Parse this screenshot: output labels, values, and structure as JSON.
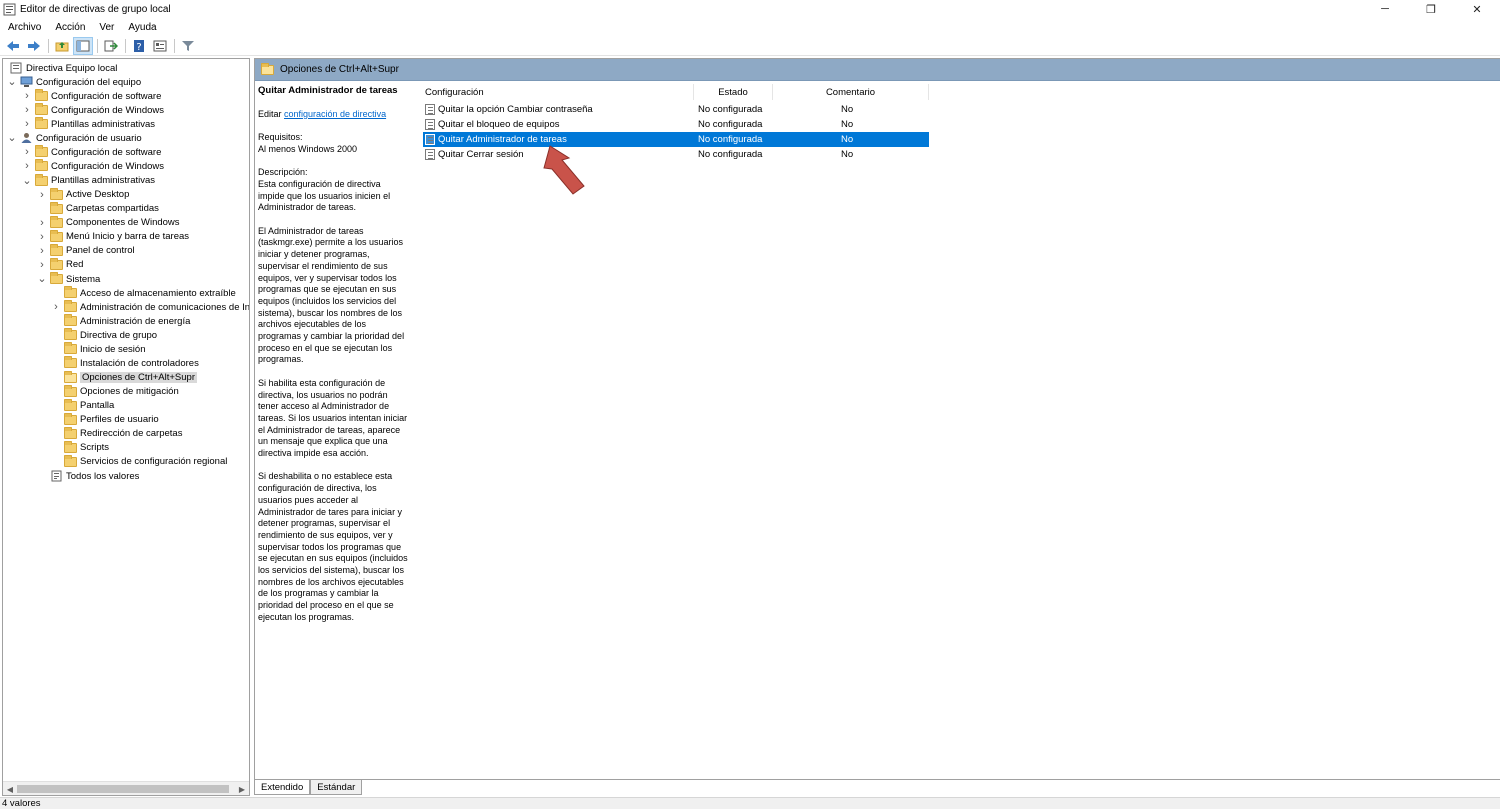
{
  "window": {
    "title": "Editor de directivas de grupo local",
    "icon": "gpedit-icon",
    "controls": [
      "minimize",
      "restore",
      "close"
    ]
  },
  "menu": [
    "Archivo",
    "Acción",
    "Ver",
    "Ayuda"
  ],
  "toolbar": [
    "back",
    "forward",
    "up-folder",
    "show-hide-tree",
    "export",
    "help",
    "properties",
    "filter"
  ],
  "tree": [
    {
      "label": "Directiva Equipo local",
      "depth": 0,
      "chev": "",
      "icon": "policy-icon"
    },
    {
      "label": "Configuración del equipo",
      "depth": 1,
      "chev": "v",
      "icon": "computer-icon"
    },
    {
      "label": "Configuración de software",
      "depth": 2,
      "chev": ">",
      "icon": "folder"
    },
    {
      "label": "Configuración de Windows",
      "depth": 2,
      "chev": ">",
      "icon": "folder"
    },
    {
      "label": "Plantillas administrativas",
      "depth": 2,
      "chev": ">",
      "icon": "folder"
    },
    {
      "label": "Configuración de usuario",
      "depth": 1,
      "chev": "v",
      "icon": "user-icon"
    },
    {
      "label": "Configuración de software",
      "depth": 2,
      "chev": ">",
      "icon": "folder"
    },
    {
      "label": "Configuración de Windows",
      "depth": 2,
      "chev": ">",
      "icon": "folder"
    },
    {
      "label": "Plantillas administrativas",
      "depth": 2,
      "chev": "v",
      "icon": "folder"
    },
    {
      "label": "Active Desktop",
      "depth": 3,
      "chev": ">",
      "icon": "folder"
    },
    {
      "label": "Carpetas compartidas",
      "depth": 3,
      "chev": "",
      "icon": "folder"
    },
    {
      "label": "Componentes de Windows",
      "depth": 3,
      "chev": ">",
      "icon": "folder"
    },
    {
      "label": "Menú Inicio y barra de tareas",
      "depth": 3,
      "chev": ">",
      "icon": "folder"
    },
    {
      "label": "Panel de control",
      "depth": 3,
      "chev": ">",
      "icon": "folder"
    },
    {
      "label": "Red",
      "depth": 3,
      "chev": ">",
      "icon": "folder"
    },
    {
      "label": "Sistema",
      "depth": 3,
      "chev": "v",
      "icon": "folder"
    },
    {
      "label": "Acceso de almacenamiento extraíble",
      "depth": 4,
      "chev": "",
      "icon": "folder"
    },
    {
      "label": "Administración de comunicaciones de In",
      "depth": 4,
      "chev": ">",
      "icon": "folder"
    },
    {
      "label": "Administración de energía",
      "depth": 4,
      "chev": "",
      "icon": "folder"
    },
    {
      "label": "Directiva de grupo",
      "depth": 4,
      "chev": "",
      "icon": "folder"
    },
    {
      "label": "Inicio de sesión",
      "depth": 4,
      "chev": "",
      "icon": "folder"
    },
    {
      "label": "Instalación de controladores",
      "depth": 4,
      "chev": "",
      "icon": "folder"
    },
    {
      "label": "Opciones de Ctrl+Alt+Supr",
      "depth": 4,
      "chev": "",
      "icon": "folder-open",
      "selected": true
    },
    {
      "label": "Opciones de mitigación",
      "depth": 4,
      "chev": "",
      "icon": "folder"
    },
    {
      "label": "Pantalla",
      "depth": 4,
      "chev": "",
      "icon": "folder"
    },
    {
      "label": "Perfiles de usuario",
      "depth": 4,
      "chev": "",
      "icon": "folder"
    },
    {
      "label": "Redirección de carpetas",
      "depth": 4,
      "chev": "",
      "icon": "folder"
    },
    {
      "label": "Scripts",
      "depth": 4,
      "chev": "",
      "icon": "folder"
    },
    {
      "label": "Servicios de configuración regional",
      "depth": 4,
      "chev": "",
      "icon": "folder"
    },
    {
      "label": "Todos los valores",
      "depth": 3,
      "chev": "",
      "icon": "all-settings-icon"
    }
  ],
  "header": {
    "title": "Opciones de Ctrl+Alt+Supr"
  },
  "description": {
    "title": "Quitar Administrador de tareas",
    "edit_prefix": "Editar ",
    "edit_link": "configuración de directiva",
    "requirements_label": "Requisitos:",
    "requirements_value": "Al menos Windows 2000",
    "description_label": "Descripción:",
    "paragraphs": [
      "Esta configuración de directiva\nimpide que los usuarios inicien el\nAdministrador de tareas.",
      "El Administrador de tareas\n(taskmgr.exe) permite a los usuarios\niniciar y detener programas,\nsupervisar el rendimiento de sus\nequipos, ver y supervisar todos los\nprogramas que se ejecutan en sus\nequipos (incluidos los servicios del\nsistema), buscar los nombres de los\narchivos ejecutables de los\nprogramas y cambiar la prioridad del\nproceso en el que se ejecutan los\nprogramas.",
      "Si habilita esta configuración de\ndirectiva, los usuarios no podrán\ntener acceso al Administrador de\ntareas. Si los usuarios intentan iniciar\nel Administrador de tareas, aparece\nun mensaje que explica que una\ndirectiva impide esa acción.",
      "Si deshabilita o no establece esta\nconfiguración de directiva, los\nusuarios pues acceder al\nAdministrador de tares para iniciar y\ndetener programas, supervisar el\nrendimiento de sus equipos, ver y\nsupervisar todos los programas que\nse ejecutan en sus equipos (incluidos\nlos servicios del sistema), buscar los\nnombres de los archivos ejecutables\nde los programas y cambiar la\nprioridad del proceso en el que se\nejecutan los programas."
    ]
  },
  "list": {
    "columns": [
      "Configuración",
      "Estado",
      "Comentario"
    ],
    "rows": [
      {
        "name": "Quitar la opción Cambiar contraseña",
        "state": "No configurada",
        "comment": "No"
      },
      {
        "name": "Quitar el bloqueo de equipos",
        "state": "No configurada",
        "comment": "No"
      },
      {
        "name": "Quitar Administrador de tareas",
        "state": "No configurada",
        "comment": "No",
        "selected": true
      },
      {
        "name": "Quitar Cerrar sesión",
        "state": "No configurada",
        "comment": "No"
      }
    ]
  },
  "tabs": [
    "Extendido",
    "Estándar"
  ],
  "status": "4 valores",
  "colors": {
    "header_band": "#8ea9c5",
    "selection": "#0078d7",
    "arrow": "#c9534a"
  }
}
